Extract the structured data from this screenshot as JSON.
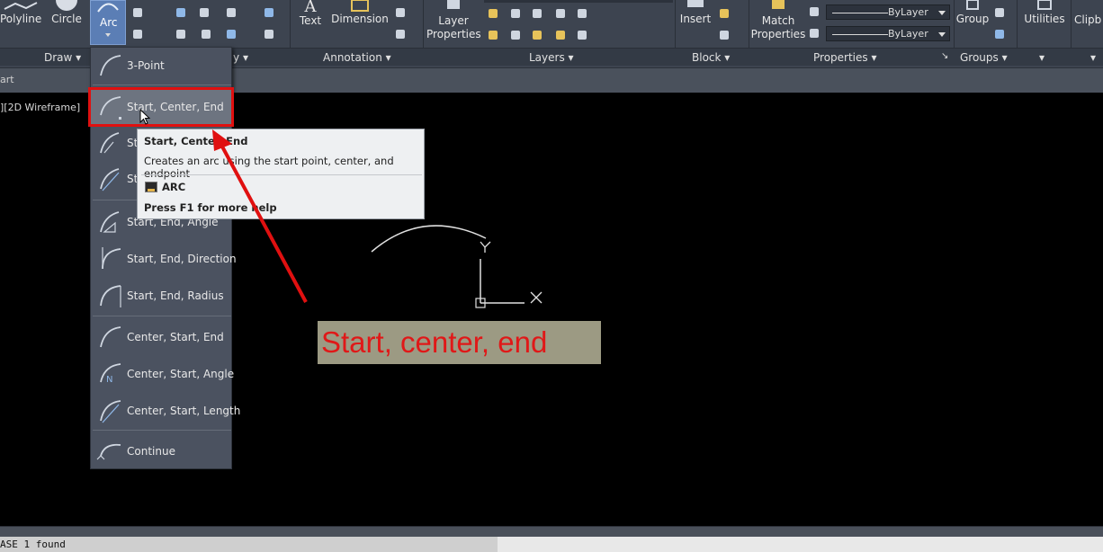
{
  "ribbon": {
    "draw": {
      "polyline": "Polyline",
      "circle": "Circle",
      "arc": "Arc",
      "panel": "Draw"
    },
    "modify": {
      "panel_suffix": "y"
    },
    "annotation": {
      "text": "Text",
      "dimension": "Dimension",
      "panel": "Annotation"
    },
    "layers": {
      "layer_properties_line1": "Layer",
      "layer_properties_line2": "Properties",
      "panel": "Layers"
    },
    "block": {
      "insert": "Insert",
      "panel": "Block"
    },
    "properties": {
      "match_line1": "Match",
      "match_line2": "Properties",
      "bylayer_1": "ByLayer",
      "bylayer_2": "ByLayer",
      "panel": "Properties"
    },
    "groups": {
      "group": "Group",
      "panel": "Groups"
    },
    "utilities": {
      "label": "Utilities"
    },
    "clipboard": {
      "label": "Clipb"
    }
  },
  "file_tab": {
    "label": "art"
  },
  "viewport": {
    "label": "][2D Wireframe]"
  },
  "arc_menu": {
    "items": [
      {
        "label": "3-Point"
      },
      {
        "label": "Start, Center, End"
      },
      {
        "label": "Sta"
      },
      {
        "label": "Sta"
      },
      {
        "label": "Start, End, Angle"
      },
      {
        "label": "Start, End, Direction"
      },
      {
        "label": "Start, End, Radius"
      },
      {
        "label": "Center, Start, End"
      },
      {
        "label": "Center, Start, Angle"
      },
      {
        "label": "Center, Start, Length"
      },
      {
        "label": "Continue"
      }
    ]
  },
  "tooltip": {
    "title": "Start, Center, End",
    "description": "Creates an arc using the start point, center, and endpoint",
    "command": "ARC",
    "help": "Press F1 for more help"
  },
  "annotation": {
    "text": "Start, center, end"
  },
  "command_line": {
    "text": "ASE 1 found"
  },
  "colors": {
    "highlight": "#e01010",
    "annotation_text": "#e01818",
    "annotation_bg": "#9c9a83",
    "ribbon_bg": "#3d4450",
    "canvas_bg": "#000000"
  }
}
